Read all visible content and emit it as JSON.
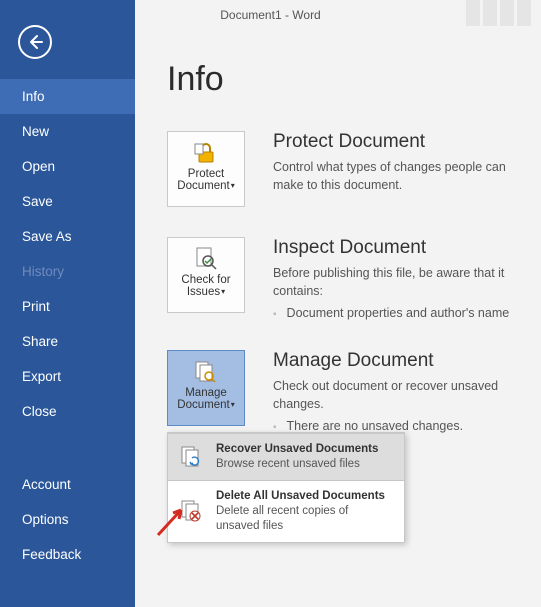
{
  "window": {
    "title": "Document1 - Word"
  },
  "sidebar": {
    "items": [
      {
        "label": "Info",
        "selected": true
      },
      {
        "label": "New"
      },
      {
        "label": "Open"
      },
      {
        "label": "Save"
      },
      {
        "label": "Save As"
      },
      {
        "label": "History",
        "disabled": true
      },
      {
        "label": "Print"
      },
      {
        "label": "Share"
      },
      {
        "label": "Export"
      },
      {
        "label": "Close"
      }
    ],
    "footer": [
      {
        "label": "Account"
      },
      {
        "label": "Options"
      },
      {
        "label": "Feedback"
      }
    ]
  },
  "page": {
    "title": "Info"
  },
  "protect": {
    "tile": "Protect Document",
    "heading": "Protect Document",
    "desc": "Control what types of changes people can make to this document."
  },
  "inspect": {
    "tile": "Check for Issues",
    "heading": "Inspect Document",
    "desc": "Before publishing this file, be aware that it contains:",
    "bullet": "Document properties and author's name"
  },
  "manage": {
    "tile": "Manage Document",
    "heading": "Manage Document",
    "desc": "Check out document or recover unsaved changes.",
    "bullet": "There are no unsaved changes.",
    "menu": {
      "recover": {
        "title": "Recover Unsaved Documents",
        "sub": "Browse recent unsaved files"
      },
      "delete": {
        "title": "Delete All Unsaved Documents",
        "sub": "Delete all recent copies of unsaved files"
      }
    }
  }
}
